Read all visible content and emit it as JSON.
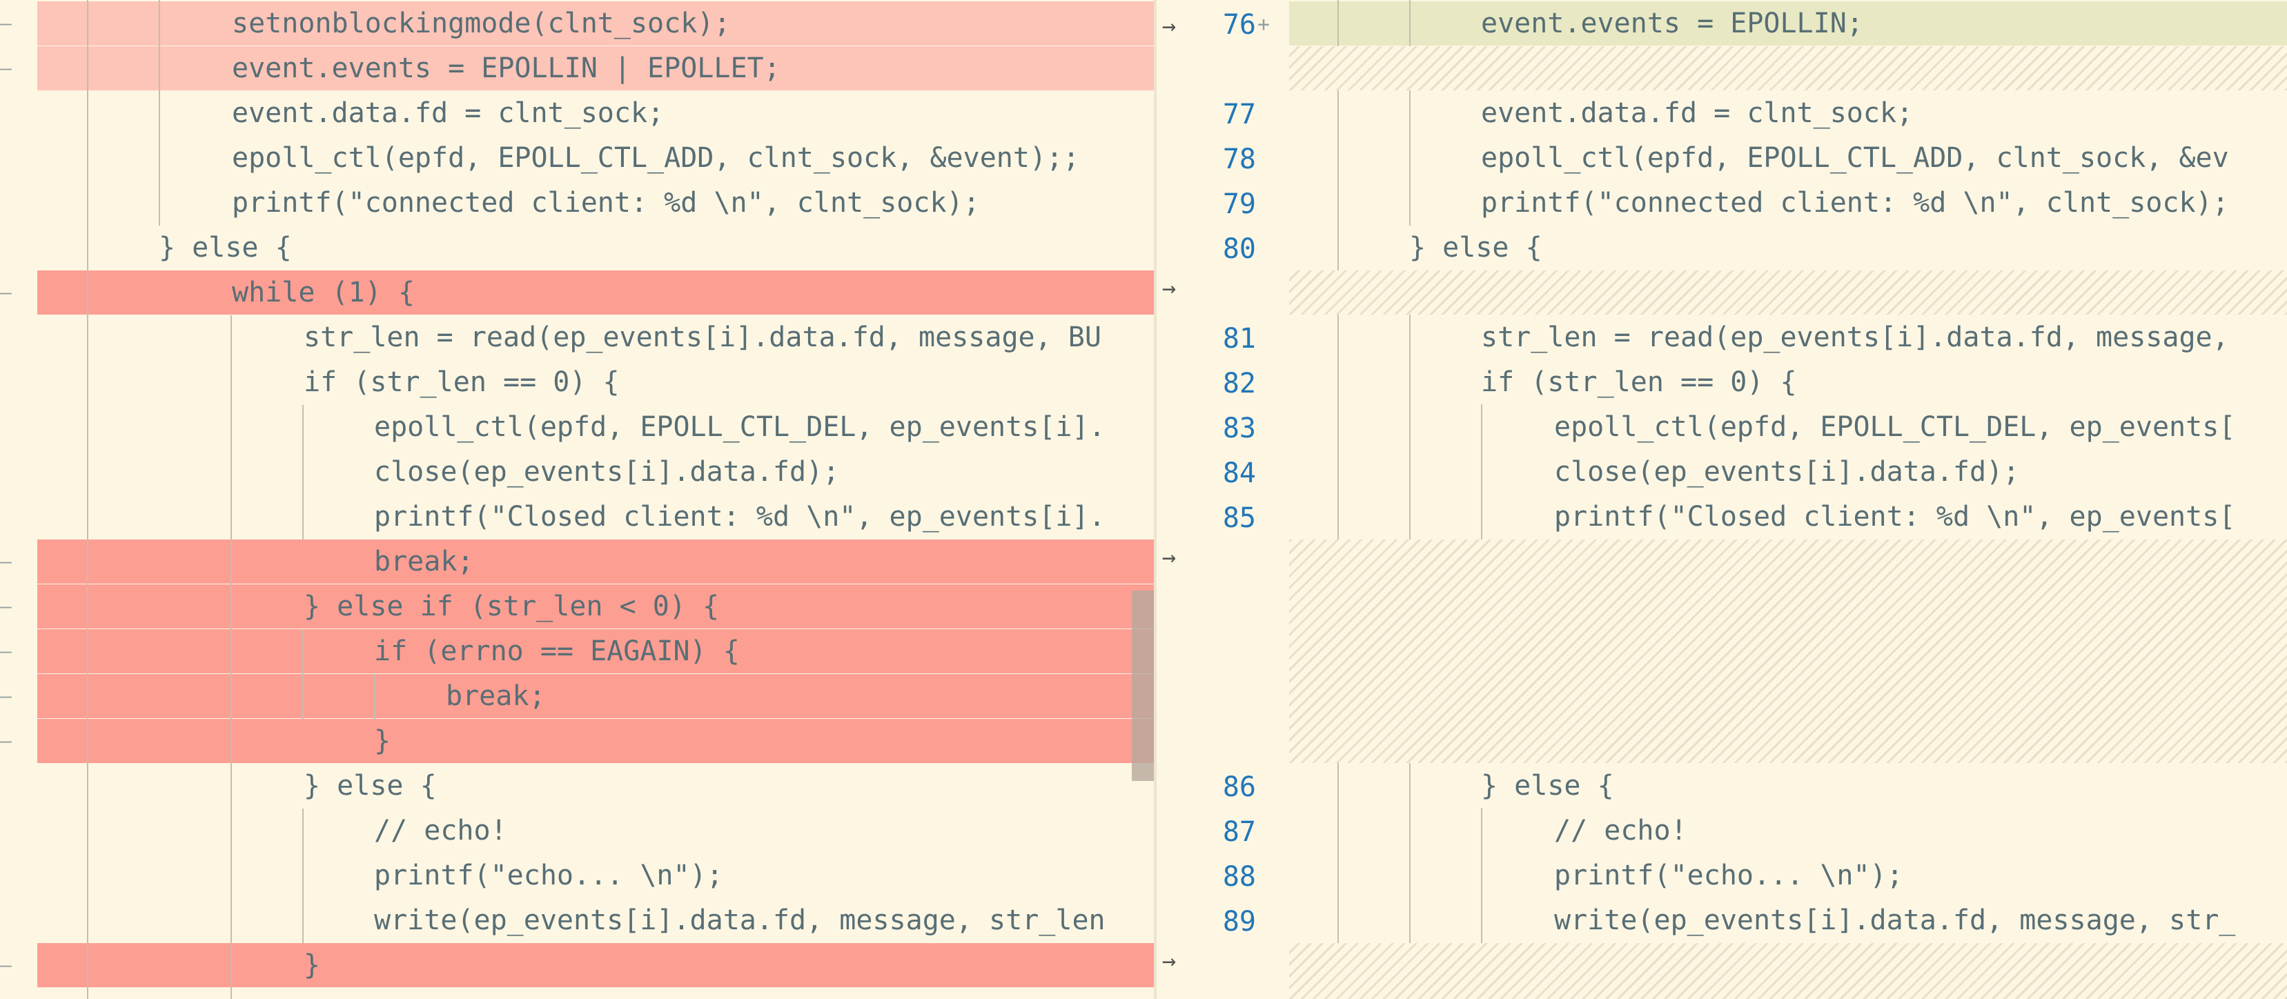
{
  "left": {
    "lines": [
      {
        "kind": "mod",
        "mark": "—",
        "text": "setnonblockingmode(clnt_sock);"
      },
      {
        "kind": "mod",
        "mark": "—",
        "text": "event.events = EPOLLIN | EPOLLET;"
      },
      {
        "kind": "ctx",
        "mark": "",
        "text": "event.data.fd = clnt_sock;"
      },
      {
        "kind": "ctx",
        "mark": "",
        "text": "epoll_ctl(epfd, EPOLL_CTL_ADD, clnt_sock, &event);;"
      },
      {
        "kind": "ctx",
        "mark": "",
        "text": "printf(\"connected client: %d \\n\", clnt_sock);"
      },
      {
        "kind": "ctx",
        "mark": "",
        "text": "} else {"
      },
      {
        "kind": "del",
        "mark": "—",
        "text": "while (1) {"
      },
      {
        "kind": "ctx",
        "mark": "",
        "text": "str_len = read(ep_events[i].data.fd, message, BU"
      },
      {
        "kind": "ctx",
        "mark": "",
        "text": "if (str_len == 0) {"
      },
      {
        "kind": "ctx",
        "mark": "",
        "text": "epoll_ctl(epfd, EPOLL_CTL_DEL, ep_events[i]."
      },
      {
        "kind": "ctx",
        "mark": "",
        "text": "close(ep_events[i].data.fd);"
      },
      {
        "kind": "ctx",
        "mark": "",
        "text": "printf(\"Closed client: %d \\n\", ep_events[i]."
      },
      {
        "kind": "del",
        "mark": "—",
        "text": "break;"
      },
      {
        "kind": "del",
        "mark": "—",
        "text": "} else if (str_len < 0) {"
      },
      {
        "kind": "del",
        "mark": "—",
        "text": "if (errno == EAGAIN) {"
      },
      {
        "kind": "del",
        "mark": "—",
        "text": "break;"
      },
      {
        "kind": "del",
        "mark": "—",
        "text": "}"
      },
      {
        "kind": "ctx",
        "mark": "",
        "text": "} else {"
      },
      {
        "kind": "ctx",
        "mark": "",
        "text": "// echo!"
      },
      {
        "kind": "ctx",
        "mark": "",
        "text": "printf(\"echo... \\n\");"
      },
      {
        "kind": "ctx",
        "mark": "",
        "text": "write(ep_events[i].data.fd, message, str_len"
      },
      {
        "kind": "del",
        "mark": "—",
        "text": "}"
      }
    ]
  },
  "right": {
    "lines": [
      {
        "kind": "add",
        "num": "76",
        "plus": "+",
        "text": "event.events = EPOLLIN;"
      },
      {
        "kind": "gap",
        "num": "",
        "text": ""
      },
      {
        "kind": "ctx",
        "num": "77",
        "text": "event.data.fd = clnt_sock;"
      },
      {
        "kind": "ctx",
        "num": "78",
        "text": "epoll_ctl(epfd, EPOLL_CTL_ADD, clnt_sock, &ev"
      },
      {
        "kind": "ctx",
        "num": "79",
        "text": "printf(\"connected client: %d \\n\", clnt_sock);"
      },
      {
        "kind": "ctx",
        "num": "80",
        "text": "} else {"
      },
      {
        "kind": "gap",
        "num": "",
        "text": ""
      },
      {
        "kind": "ctx",
        "num": "81",
        "text": "str_len = read(ep_events[i].data.fd, message,"
      },
      {
        "kind": "ctx",
        "num": "82",
        "text": "if (str_len == 0) {"
      },
      {
        "kind": "ctx",
        "num": "83",
        "text": "epoll_ctl(epfd, EPOLL_CTL_DEL, ep_events["
      },
      {
        "kind": "ctx",
        "num": "84",
        "text": "close(ep_events[i].data.fd);"
      },
      {
        "kind": "ctx",
        "num": "85",
        "text": "printf(\"Closed client: %d \\n\", ep_events["
      },
      {
        "kind": "gap",
        "num": "",
        "text": ""
      },
      {
        "kind": "gap",
        "num": "",
        "text": ""
      },
      {
        "kind": "gap",
        "num": "",
        "text": ""
      },
      {
        "kind": "gap",
        "num": "",
        "text": ""
      },
      {
        "kind": "gap",
        "num": "",
        "text": ""
      },
      {
        "kind": "ctx",
        "num": "86",
        "text": "} else {"
      },
      {
        "kind": "ctx",
        "num": "87",
        "text": "// echo!"
      },
      {
        "kind": "ctx",
        "num": "88",
        "text": "printf(\"echo... \\n\");"
      },
      {
        "kind": "ctx",
        "num": "89",
        "text": "write(ep_events[i].data.fd, message, str_"
      },
      {
        "kind": "gap",
        "num": "",
        "text": ""
      }
    ]
  },
  "arrows": {
    "row0": "→",
    "row6": "→",
    "row12": "→",
    "row21": "→"
  },
  "colors": {
    "background": "#fdf6e3",
    "deleted": "#fd9e93",
    "modified": "#fdc4b8",
    "added": "#e8e9c4",
    "line_number": "#2176b8",
    "text": "#586e75"
  }
}
